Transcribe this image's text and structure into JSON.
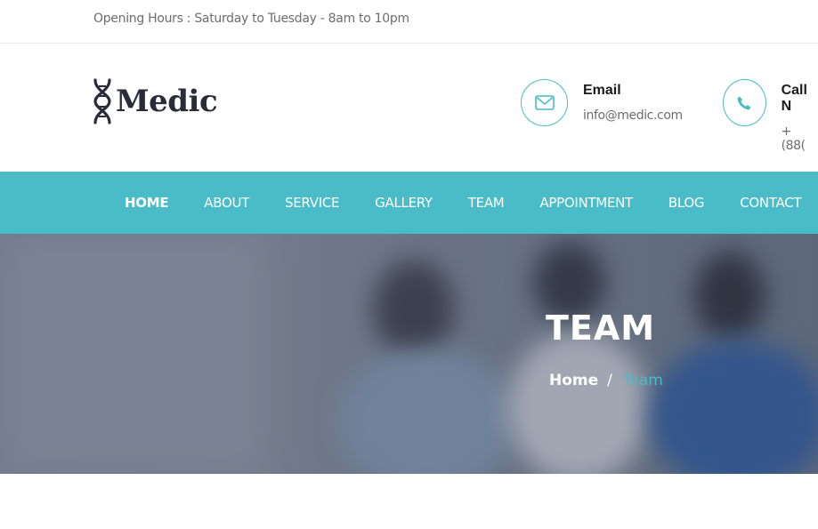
{
  "topbar": {
    "hours": "Opening Hours : Saturday to Tuesday - 8am to 10pm"
  },
  "header": {
    "logo_text": "Medic",
    "logo_icon": "dna-icon",
    "email": {
      "icon": "envelope-icon",
      "title": "Email",
      "value": "info@medic.com"
    },
    "call": {
      "icon": "phone-icon",
      "title": "Call N",
      "value": "+ (88("
    }
  },
  "nav": {
    "items": [
      "HOME",
      "ABOUT",
      "SERVICE",
      "GALLERY",
      "TEAM",
      "APPOINTMENT",
      "BLOG",
      "CONTACT"
    ],
    "active": "HOME"
  },
  "hero": {
    "title": "TEAM",
    "breadcrumb": {
      "home": "Home",
      "separator": "/",
      "current": "Team"
    }
  },
  "colors": {
    "accent": "#49bcc8",
    "text_dark": "#1b1b1b",
    "text_muted": "#6d6d6d"
  }
}
